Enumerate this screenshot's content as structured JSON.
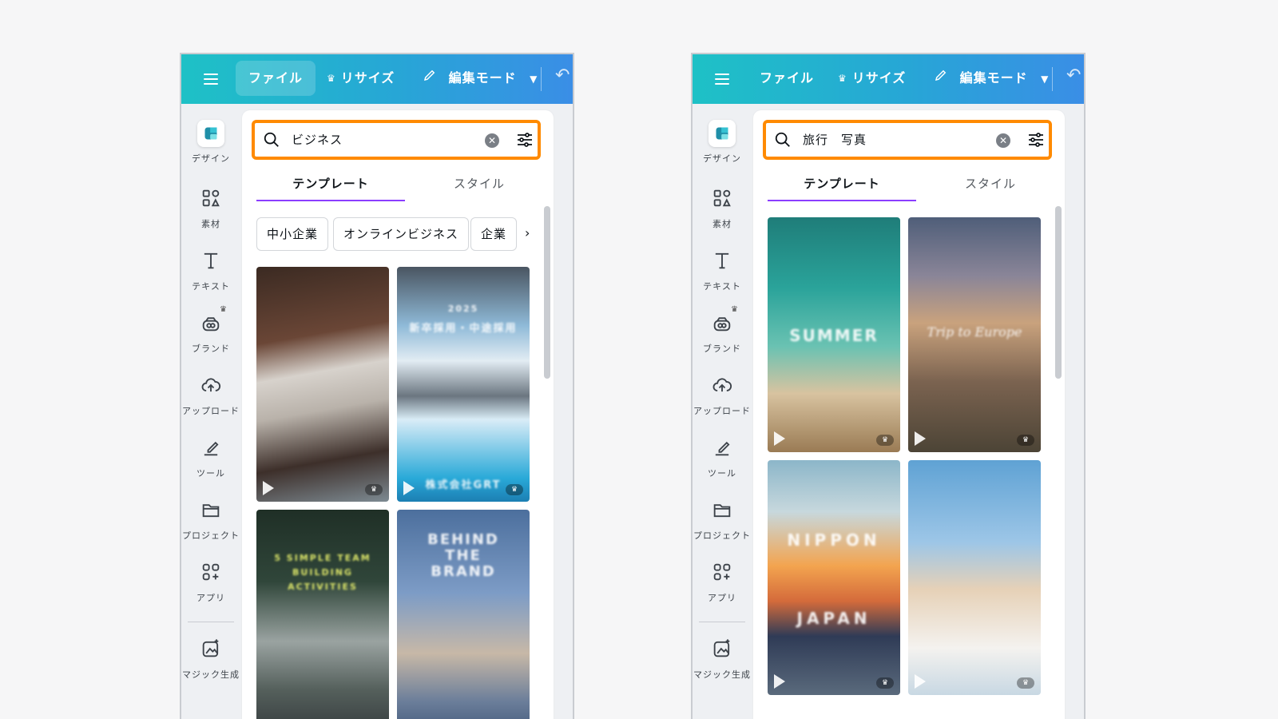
{
  "topbar": {
    "file_label": "ファイル",
    "resize_label": "リサイズ",
    "edit_mode_label": "編集モード"
  },
  "sidebar": {
    "items": [
      {
        "label": "デザイン",
        "icon": "design-icon"
      },
      {
        "label": "素材",
        "icon": "elements-icon"
      },
      {
        "label": "テキスト",
        "icon": "text-icon"
      },
      {
        "label": "ブランド",
        "icon": "brand-icon"
      },
      {
        "label": "アップロード",
        "icon": "upload-icon"
      },
      {
        "label": "ツール",
        "icon": "tools-icon"
      },
      {
        "label": "プロジェクト",
        "icon": "folder-icon"
      },
      {
        "label": "アプリ",
        "icon": "apps-icon"
      },
      {
        "label": "マジック生成",
        "icon": "magic-generate-icon"
      }
    ]
  },
  "tabs": {
    "templates": "テンプレート",
    "styles": "スタイル"
  },
  "left": {
    "search_value": "ビジネス",
    "chips": [
      "中小企業",
      "オンラインビジネス",
      "企業"
    ],
    "thumb_texts": {
      "recruit_year": "2025",
      "recruit_title": "新卒採用・中途採用",
      "recruit_company": "株式会社GRT",
      "team_title": "5 SIMPLE TEAM BUILDING ACTIVITIES",
      "brand_title": "BEHIND THE BRAND"
    }
  },
  "right": {
    "search_value": "旅行　写真",
    "thumb_texts": {
      "summer": "SUMMER",
      "europe": "Trip to Europe",
      "nippon": "NIPPON",
      "japan": "JAPAN"
    }
  },
  "colors": {
    "accent_orange": "#ff8a00",
    "tab_underline": "#8b3dff",
    "topbar_start": "#1ec1c6",
    "topbar_end": "#3a8ee6"
  }
}
